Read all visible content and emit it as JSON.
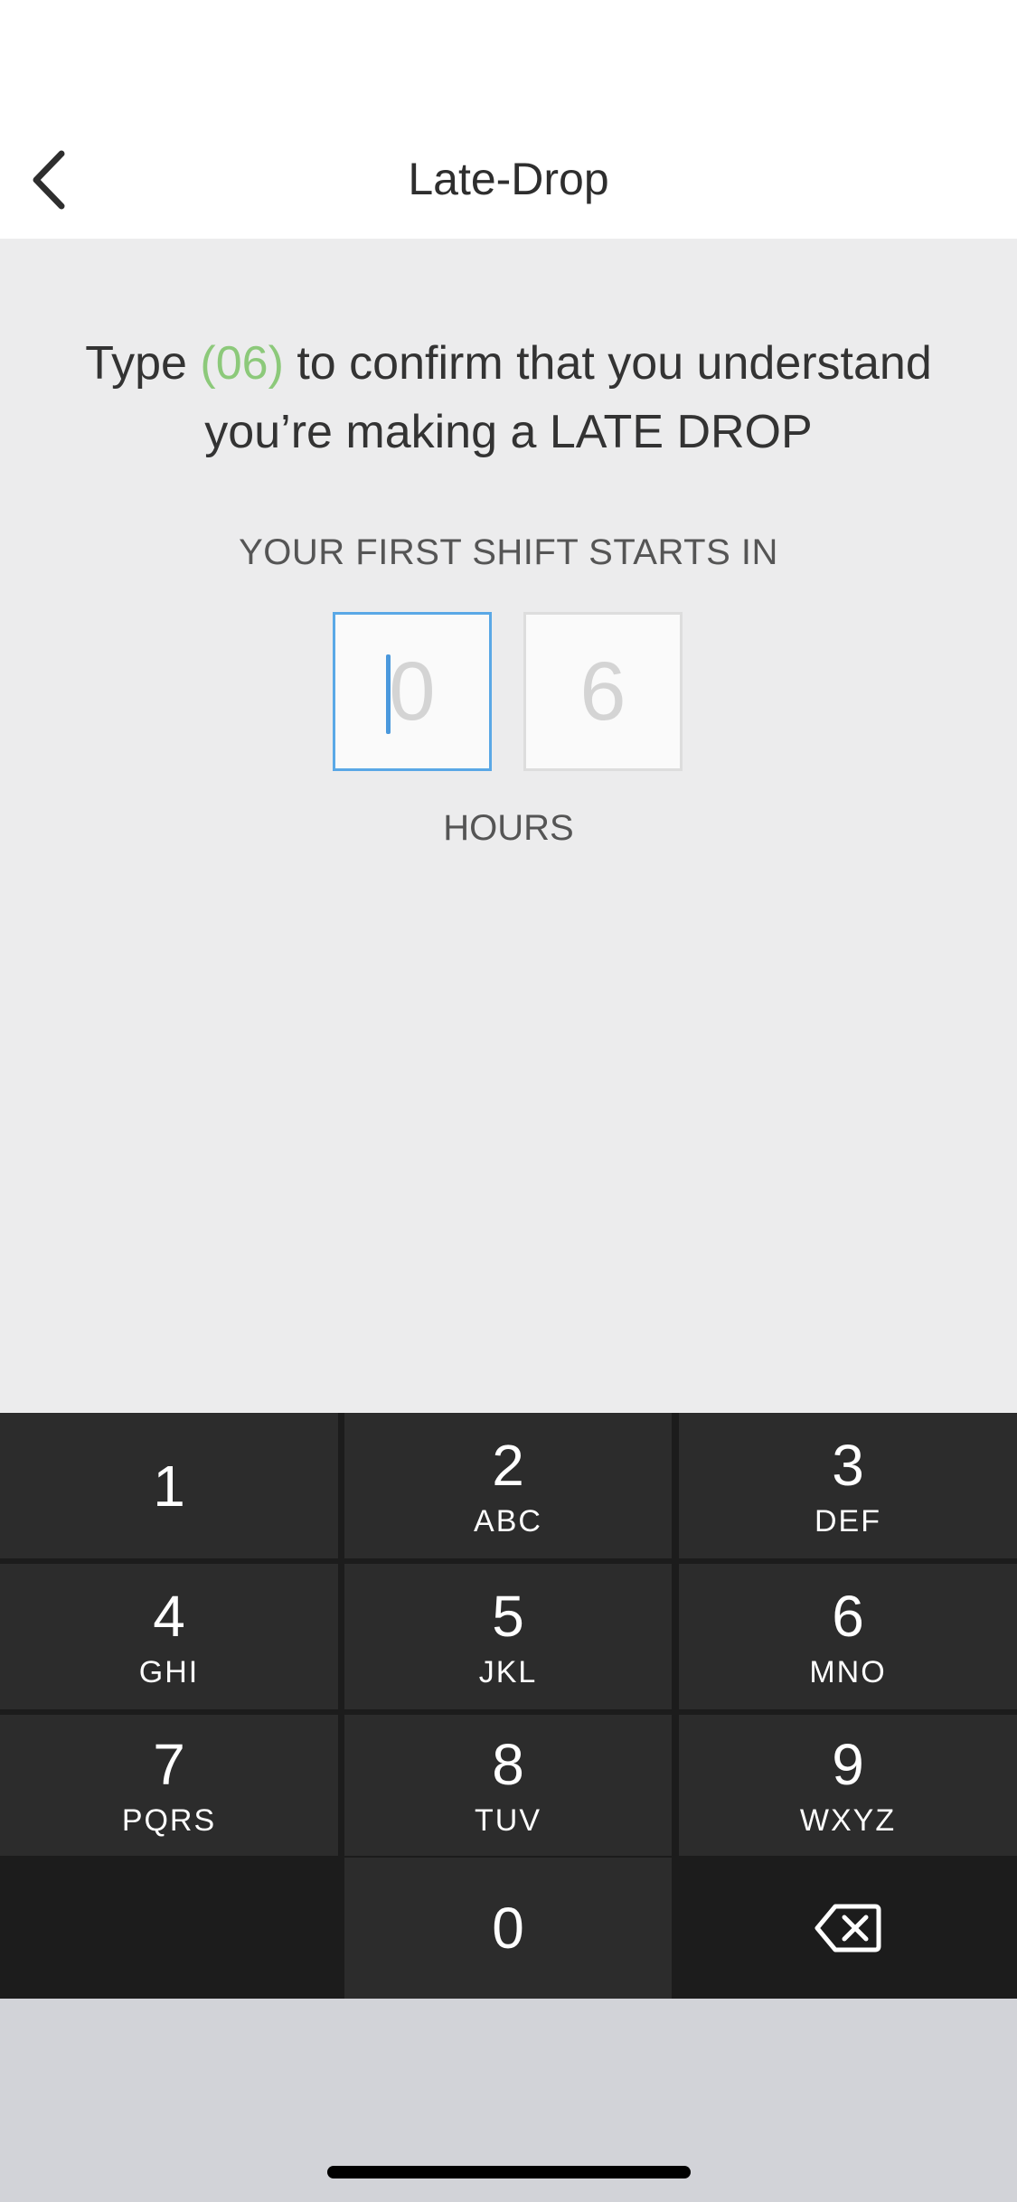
{
  "header": {
    "title": "Late-Drop",
    "back_icon": "chevron-left-icon"
  },
  "instruction": {
    "prefix": "Type ",
    "code": "(06)",
    "suffix": " to confirm that you understand you’re making a LATE DROP",
    "code_color": "#8cc97a"
  },
  "confirm": {
    "subtitle": "YOUR FIRST SHIFT STARTS IN",
    "digits": [
      "0",
      "6"
    ],
    "active_digit_index": 0,
    "active_border_color": "#5aa8e6",
    "unit_label": "HOURS"
  },
  "keypad": {
    "keys": [
      {
        "num": "1",
        "letters": ""
      },
      {
        "num": "2",
        "letters": "ABC"
      },
      {
        "num": "3",
        "letters": "DEF"
      },
      {
        "num": "4",
        "letters": "GHI"
      },
      {
        "num": "5",
        "letters": "JKL"
      },
      {
        "num": "6",
        "letters": "MNO"
      },
      {
        "num": "7",
        "letters": "PQRS"
      },
      {
        "num": "8",
        "letters": "TUV"
      },
      {
        "num": "9",
        "letters": "WXYZ"
      },
      {
        "num": "0",
        "letters": ""
      }
    ],
    "delete_icon": "backspace-icon"
  }
}
